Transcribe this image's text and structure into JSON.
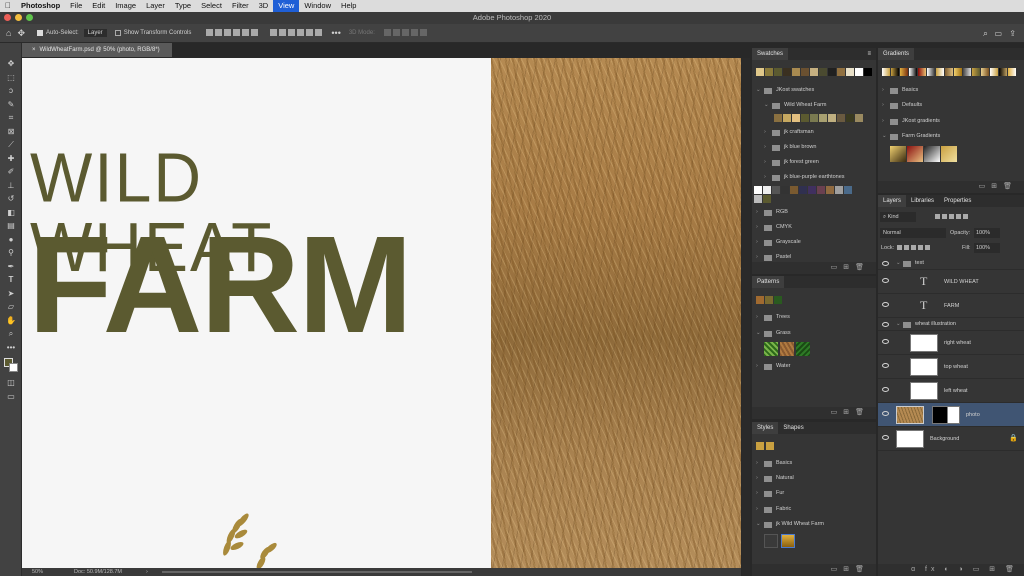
{
  "menubar": {
    "apple": "",
    "app": "Photoshop",
    "items": [
      "File",
      "Edit",
      "Image",
      "Layer",
      "Type",
      "Select",
      "Filter",
      "3D",
      "View",
      "Window",
      "Help"
    ],
    "active": "View"
  },
  "window_title": "Adobe Photoshop 2020",
  "options": {
    "auto_select_label": "Auto-Select:",
    "auto_select_value": "Layer",
    "transform_label": "Show Transform Controls",
    "mode_3d": "3D Mode:"
  },
  "document_tab": "WildWheatFarm.psd @ 50% (photo, RGB/8*)",
  "canvas": {
    "line1": "WILD WHEAT",
    "line2": "FARM",
    "text_color": "#5b5a30"
  },
  "status": {
    "zoom": "50%",
    "doc": "Doc: 50.9M/128.7M",
    "arrow": "›"
  },
  "swatches": {
    "tab": "Swatches",
    "groups": [
      {
        "label": "JKost swatches",
        "open": true
      },
      {
        "label": "Wild Wheat Farm",
        "open": true,
        "indent": 1
      },
      {
        "label": "jk craftsman",
        "indent": 1
      },
      {
        "label": "jk blue brown",
        "indent": 1
      },
      {
        "label": "jk forest green",
        "indent": 1
      },
      {
        "label": "jk blue-purple earthtones",
        "indent": 1
      },
      {
        "label": "RGB"
      },
      {
        "label": "CMYK"
      },
      {
        "label": "Grayscale"
      },
      {
        "label": "Pastel"
      }
    ]
  },
  "gradients": {
    "tab": "Gradients",
    "groups": [
      {
        "label": "Basics"
      },
      {
        "label": "Defaults"
      },
      {
        "label": "JKost gradients"
      },
      {
        "label": "Farm Gradients",
        "open": true
      }
    ]
  },
  "patterns": {
    "tab": "Patterns",
    "groups": [
      {
        "label": "Trees"
      },
      {
        "label": "Grass",
        "open": true
      },
      {
        "label": "Water"
      }
    ]
  },
  "styles": {
    "tabs": [
      "Styles",
      "Shapes"
    ],
    "groups": [
      {
        "label": "Basics"
      },
      {
        "label": "Natural"
      },
      {
        "label": "Fur"
      },
      {
        "label": "Fabric"
      },
      {
        "label": "jk Wild Wheat Farm",
        "open": true
      }
    ]
  },
  "layers_panel": {
    "tabs": [
      "Layers",
      "Libraries",
      "Properties"
    ],
    "kind": "Kind",
    "blend": "Normal",
    "opacity_label": "Opacity:",
    "opacity": "100%",
    "lock_label": "Lock:",
    "fill_label": "Fill:",
    "fill": "100%",
    "layers": [
      {
        "name": "text",
        "type": "group"
      },
      {
        "name": "WILD WHEAT",
        "type": "text"
      },
      {
        "name": "FARM",
        "type": "text"
      },
      {
        "name": "wheat illustration",
        "type": "group"
      },
      {
        "name": "right wheat",
        "type": "image"
      },
      {
        "name": "top wheat",
        "type": "image"
      },
      {
        "name": "left wheat",
        "type": "image"
      },
      {
        "name": "photo",
        "type": "photo",
        "selected": true
      },
      {
        "name": "Background",
        "type": "background"
      }
    ],
    "bottom_icons": "ɑ fx ◐ ◑ ▭ ⊞ 🗑"
  }
}
